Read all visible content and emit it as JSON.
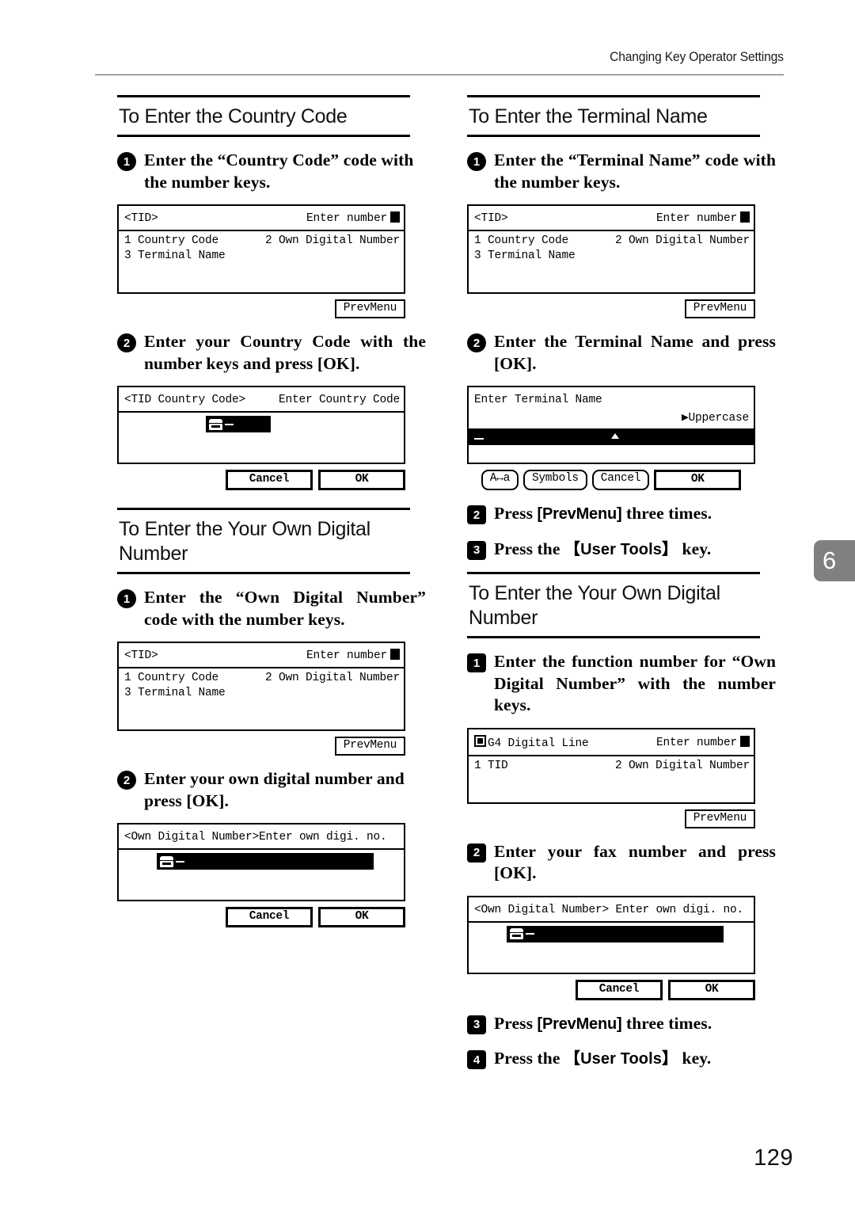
{
  "header": {
    "running_head": "Changing Key Operator Settings"
  },
  "chapter_tab": {
    "number": "6"
  },
  "page_number": "129",
  "left_column": {
    "section1": {
      "title": "To Enter the Country Code",
      "step1": {
        "marker": "1",
        "text": "Enter the “Country Code” code with the number keys."
      },
      "screen1": {
        "title": "<TID>",
        "status": "Enter number",
        "items": [
          {
            "left": "1 Country Code",
            "right": "2 Own Digital Number"
          },
          {
            "left": "3 Terminal Name",
            "right": ""
          }
        ],
        "button": "PrevMenu"
      },
      "step2": {
        "marker": "2",
        "text": "Enter your Country Code with the number keys and press [OK]."
      },
      "screen2": {
        "title": "<TID Country Code>",
        "status": "Enter Country Code",
        "icon": "phone-icon",
        "buttons": [
          "Cancel",
          "OK"
        ]
      }
    },
    "section2": {
      "title": "To Enter the Your Own Digital Number",
      "step1": {
        "marker": "1",
        "text": "Enter the “Own Digital Number” code with the number keys."
      },
      "screen1": {
        "title": "<TID>",
        "status": "Enter number",
        "items": [
          {
            "left": "1 Country Code",
            "right": "2 Own Digital Number"
          },
          {
            "left": "3 Terminal Name",
            "right": ""
          }
        ],
        "button": "PrevMenu"
      },
      "step2": {
        "marker": "2",
        "text": "Enter your own digital number and press [OK]."
      },
      "screen2": {
        "title": "<Own Digital Number>Enter own digi. no.",
        "icon": "phone-icon",
        "buttons": [
          "Cancel",
          "OK"
        ]
      }
    }
  },
  "right_column": {
    "section1": {
      "title": "To Enter the Terminal Name",
      "step1": {
        "marker": "1",
        "text": "Enter the “Terminal Name” code with the number keys."
      },
      "screen1": {
        "title": "<TID>",
        "status": "Enter number",
        "items": [
          {
            "left": "1 Country Code",
            "right": "2 Own Digital Number"
          },
          {
            "left": "3 Terminal Name",
            "right": ""
          }
        ],
        "button": "PrevMenu"
      },
      "step2": {
        "marker": "2",
        "text": "Enter the Terminal Name and press [OK]."
      },
      "screen2": {
        "prompt": "Enter Terminal Name",
        "mode": "▶Uppercase",
        "buttons": [
          "A↔a",
          "Symbols",
          "Cancel",
          "OK"
        ]
      },
      "step3": {
        "marker": "2",
        "text_before": "Press ",
        "key": "[PrevMenu]",
        "text_after": " three times."
      },
      "step4": {
        "marker": "3",
        "text_before": "Press the ",
        "key": "【User Tools】",
        "text_after": " key."
      }
    },
    "section2": {
      "title": "To Enter the Your Own Digital Number",
      "step1": {
        "marker": "1",
        "text": "Enter the function number for “Own Digital Number” with the number keys."
      },
      "screen1": {
        "title": "G4 Digital Line",
        "status": "Enter number",
        "items": [
          {
            "left": "1 TID",
            "right": "2 Own Digital Number"
          }
        ],
        "button": "PrevMenu"
      },
      "step2": {
        "marker": "2",
        "text": "Enter your fax number and press [OK]."
      },
      "screen2": {
        "title": "<Own Digital Number> Enter own digi. no.",
        "icon": "phone-icon",
        "buttons": [
          "Cancel",
          "OK"
        ]
      },
      "step3": {
        "marker": "3",
        "text_before": "Press ",
        "key": "[PrevMenu]",
        "text_after": " three times."
      },
      "step4": {
        "marker": "4",
        "text_before": "Press the ",
        "key": "【User Tools】",
        "text_after": " key."
      }
    }
  }
}
